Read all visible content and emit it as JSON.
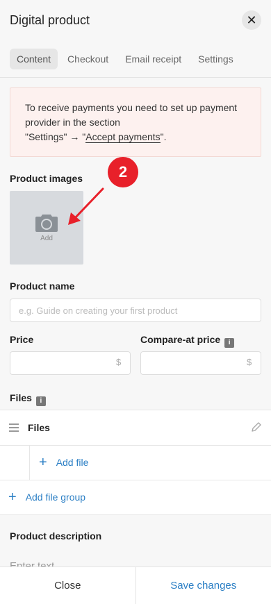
{
  "header": {
    "title": "Digital product",
    "close_glyph": "✕"
  },
  "tabs": [
    {
      "label": "Content",
      "active": true
    },
    {
      "label": "Checkout",
      "active": false
    },
    {
      "label": "Email receipt",
      "active": false
    },
    {
      "label": "Settings",
      "active": false
    }
  ],
  "alert": {
    "line1": "To receive payments you need to set up payment provider in the section",
    "settings_ref": "\"Settings\" → \"",
    "link": "Accept payments",
    "tail": "\"."
  },
  "annotation": {
    "step": "2",
    "color": "#e8202a"
  },
  "product_images": {
    "label": "Product images",
    "add_label": "Add",
    "icon": "camera-icon"
  },
  "product_name": {
    "label": "Product name",
    "placeholder": "e.g. Guide on creating your first product",
    "value": ""
  },
  "price": {
    "label": "Price",
    "value": "",
    "currency": "$"
  },
  "compare_price": {
    "label": "Compare-at price",
    "value": "",
    "currency": "$"
  },
  "files_section": {
    "label": "Files",
    "group_name": "Files",
    "add_file": "Add file",
    "add_group": "Add file group"
  },
  "description": {
    "label": "Product description",
    "placeholder": "Enter text"
  },
  "footer": {
    "close": "Close",
    "save": "Save changes"
  },
  "colors": {
    "accent": "#2b7fc5",
    "alert_bg": "#fdf1ef"
  }
}
